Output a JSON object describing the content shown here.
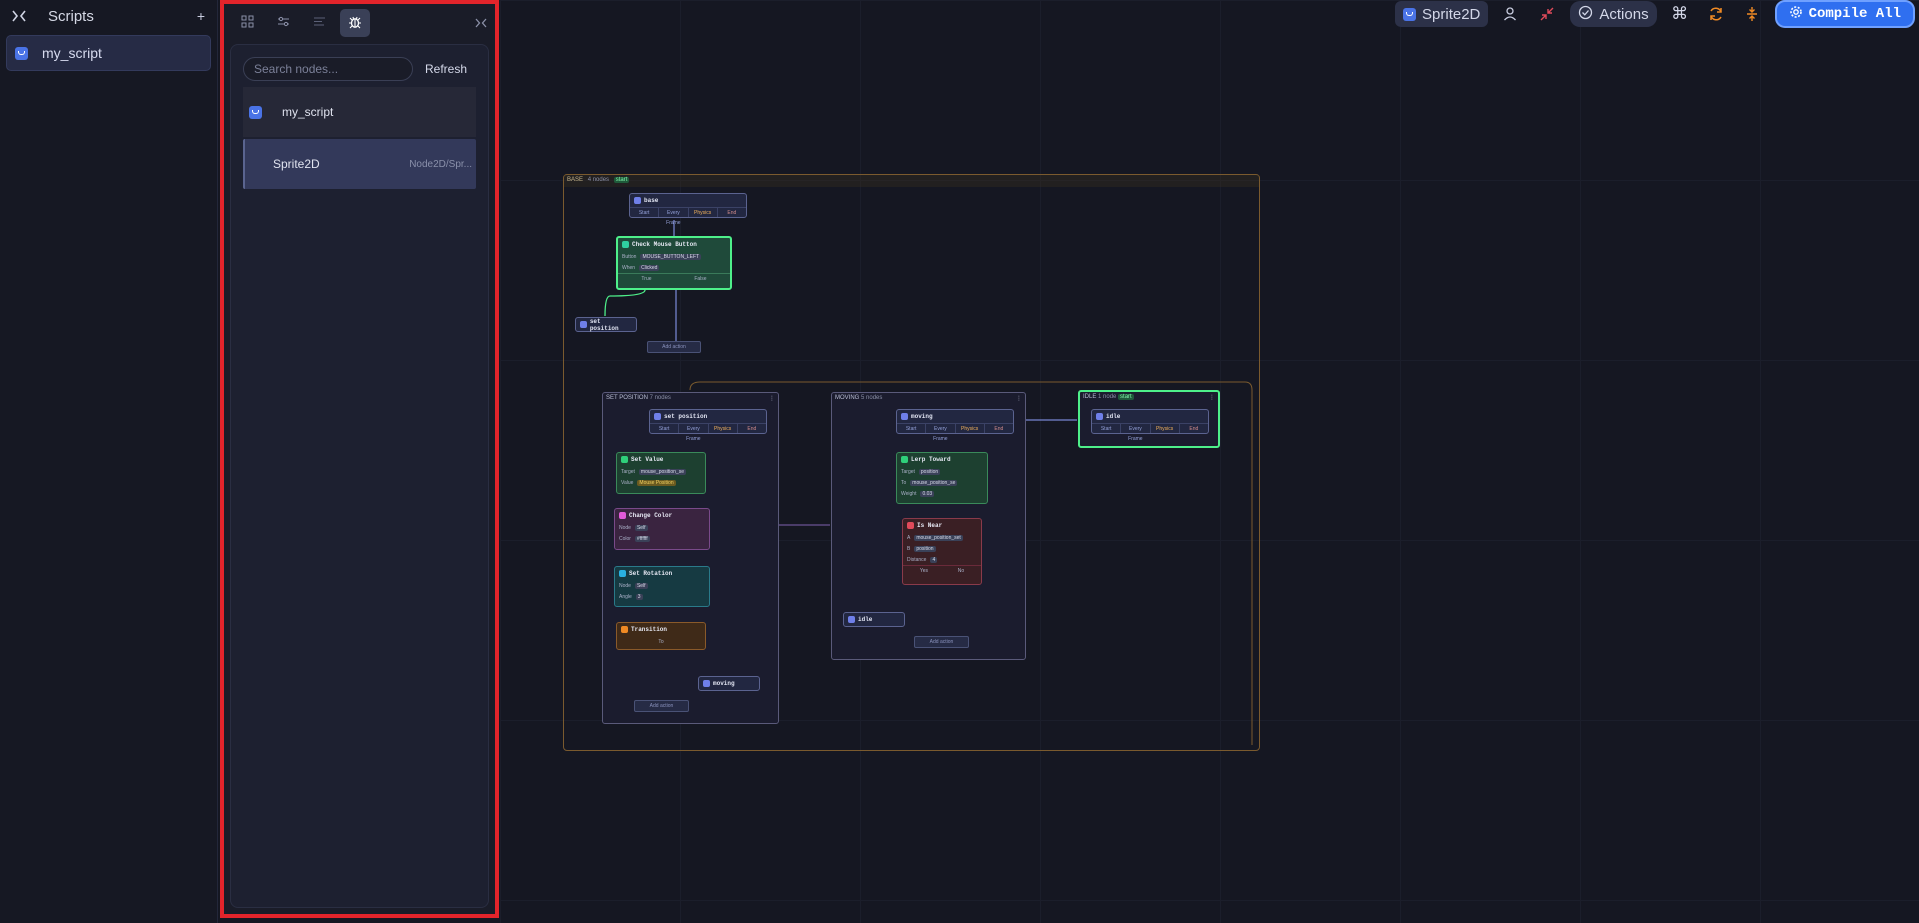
{
  "scripts_panel": {
    "title": "Scripts",
    "add_icon": "plus-icon",
    "items": [
      {
        "label": "my_script"
      }
    ]
  },
  "node_panel": {
    "tabs": [
      "grid-icon",
      "sliders-icon",
      "list-icon",
      "bug-icon"
    ],
    "active_tab": 3,
    "search": {
      "placeholder": "Search nodes...",
      "value": ""
    },
    "refresh_label": "Refresh",
    "tree": [
      {
        "label": "my_script",
        "type": ""
      },
      {
        "label": "Sprite2D",
        "type": "Node2D/Spr..."
      }
    ]
  },
  "toolbar": {
    "node_name": "Sprite2D",
    "actions_label": "Actions",
    "compile_label": "Compile All",
    "colors": {
      "accent": "#2f6ff0",
      "orange": "#f08a24"
    }
  },
  "graph": {
    "base_frame": {
      "title": "BASE",
      "count": "4 nodes",
      "badge": "start"
    },
    "base_node": {
      "title": "base",
      "tabs": [
        "Start",
        "Every Frame",
        "Physics",
        "End"
      ]
    },
    "check_mouse": {
      "title": "Check Mouse Button",
      "button_label": "Button",
      "button_value": "MOUSE_BUTTON_LEFT",
      "when_label": "When",
      "when_value": "Clicked",
      "true_label": "True",
      "false_label": "False"
    },
    "set_position_ref": "set position",
    "add_action": "Add action",
    "set_position_group": {
      "title": "SET POSITION",
      "count": "7 nodes"
    },
    "set_position_node": {
      "title": "set position",
      "tabs": [
        "Start",
        "Every Frame",
        "Physics",
        "End"
      ]
    },
    "set_value": {
      "title": "Set Value",
      "target_label": "Target",
      "target_value": "mouse_position_se",
      "value_label": "Value",
      "value_value": "Mouse Position"
    },
    "change_color": {
      "title": "Change Color",
      "node_label": "Node",
      "node_value": "Self",
      "color_label": "Color",
      "color_value": "#ffffff"
    },
    "set_rotation": {
      "title": "Set Rotation",
      "node_label": "Node",
      "node_value": "Self",
      "angle_label": "Angle",
      "angle_value": "3"
    },
    "transition": {
      "title": "Transition",
      "to_label": "To"
    },
    "moving_ref": "moving",
    "moving_group": {
      "title": "MOVING",
      "count": "5 nodes"
    },
    "moving_node": {
      "title": "moving",
      "tabs": [
        "Start",
        "Every Frame",
        "Physics",
        "End"
      ]
    },
    "lerp_toward": {
      "title": "Lerp Toward",
      "target_label": "Target",
      "target_value": "position",
      "to_label": "To",
      "to_value": "mouse_position_se",
      "weight_label": "Weight",
      "weight_value": "0.03"
    },
    "is_near": {
      "title": "Is Near",
      "a_label": "A",
      "a_value": "mouse_position_set",
      "b_label": "B",
      "b_value": "position",
      "distance_label": "Distance",
      "distance_value": "4",
      "yes_label": "Yes",
      "no_label": "No"
    },
    "idle_ref": "idle",
    "idle_group": {
      "title": "IDLE",
      "count": "1 node",
      "badge": "start"
    },
    "idle_node": {
      "title": "idle",
      "tabs": [
        "Start",
        "Every Frame",
        "Physics",
        "End"
      ]
    }
  }
}
